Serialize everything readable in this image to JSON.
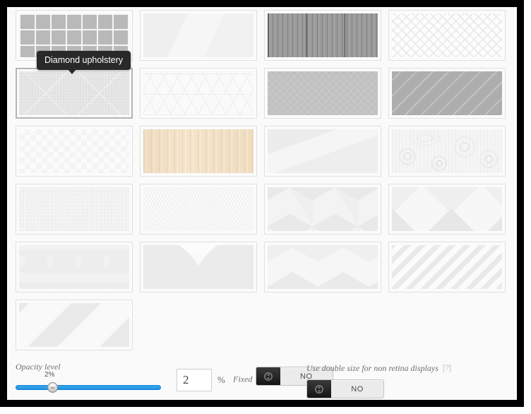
{
  "window": {
    "frame_color": "#000000",
    "background_color": "#fafafa"
  },
  "tooltip": {
    "text": "Diamond upholstery",
    "visible": true
  },
  "pattern_grid": {
    "columns": 4,
    "rows": 6,
    "selected_index": 4,
    "tiles": [
      {
        "name": "diamond-upholstery",
        "pattern": "p-diamond-uph",
        "selected": false
      },
      {
        "name": "low-poly-light",
        "pattern": "p-lowpoly-1",
        "selected": false
      },
      {
        "name": "gray-wood-planks",
        "pattern": "p-wood-gray",
        "selected": false
      },
      {
        "name": "chevron-diagonal",
        "pattern": "p-chevron",
        "selected": false
      },
      {
        "name": "diagonal-cross-canvas",
        "pattern": "p-diagcross",
        "selected": true
      },
      {
        "name": "cube-outline",
        "pattern": "p-cube-outline",
        "selected": false
      },
      {
        "name": "fine-checkerboard-gray",
        "pattern": "p-check-gray",
        "selected": false
      },
      {
        "name": "gray-diagonal-stripes",
        "pattern": "p-diag-gray",
        "selected": false
      },
      {
        "name": "faint-checkerboard",
        "pattern": "p-check-faint",
        "selected": false
      },
      {
        "name": "light-wood-beige",
        "pattern": "p-wood-beige",
        "selected": false
      },
      {
        "name": "low-poly-facets",
        "pattern": "p-lowpoly-2",
        "selected": false
      },
      {
        "name": "doodle-swirls",
        "pattern": "p-doodle",
        "selected": false
      },
      {
        "name": "noise-grain",
        "pattern": "p-noise",
        "selected": false
      },
      {
        "name": "dotted-cubes",
        "pattern": "p-dotcube",
        "selected": false
      },
      {
        "name": "isometric-cubes",
        "pattern": "p-bigcube",
        "selected": false
      },
      {
        "name": "large-triangles",
        "pattern": "p-bigtri",
        "selected": false
      },
      {
        "name": "hexagons",
        "pattern": "p-hex",
        "selected": false
      },
      {
        "name": "curved-arcs",
        "pattern": "p-arcs",
        "selected": false
      },
      {
        "name": "hexagon-cubes",
        "pattern": "p-hexcube",
        "selected": false
      },
      {
        "name": "light-diagonal-stripes",
        "pattern": "p-diag-light",
        "selected": false
      },
      {
        "name": "wide-diagonal-bands",
        "pattern": "p-bands",
        "selected": false
      }
    ]
  },
  "controls": {
    "opacity": {
      "label": "Opacity level",
      "bubble_value": "2%",
      "slider_percent": 2,
      "slider_min": 0,
      "slider_max": 100,
      "input_value": "2",
      "input_placeholder": "",
      "unit": "%",
      "track_color": "#1e93e4"
    },
    "fixed": {
      "label": "Fixed",
      "state": "NO"
    },
    "retina": {
      "label": "Use double size for non retina displays",
      "state": "NO",
      "help": "[?]"
    }
  }
}
